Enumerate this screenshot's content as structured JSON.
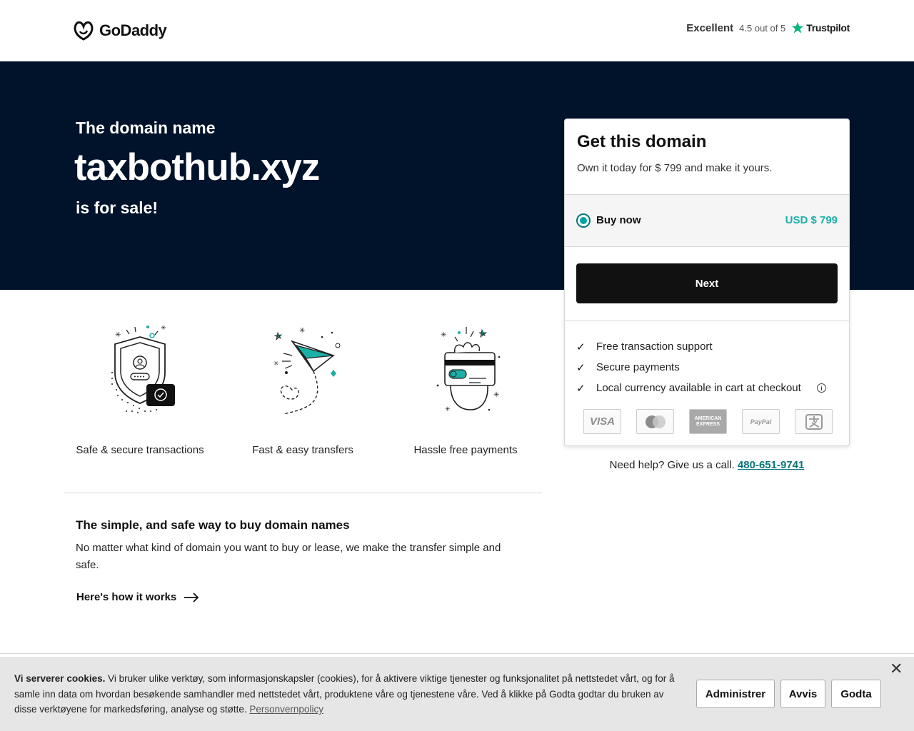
{
  "header": {
    "brand": "GoDaddy",
    "trustpilot": {
      "rating_label": "Excellent",
      "score": "4.5 out of 5",
      "brand": "Trustpilot"
    }
  },
  "hero": {
    "pre_text": "The domain name",
    "domain": "taxbothub.xyz",
    "post_text": "is for sale!"
  },
  "card": {
    "title": "Get this domain",
    "subtitle": "Own it today for $ 799 and make it yours.",
    "option_label": "Buy now",
    "option_price": "USD $ 799",
    "next_label": "Next",
    "features": [
      "Free transaction support",
      "Secure payments",
      "Local currency available in cart at checkout"
    ],
    "payment_methods": [
      "VISA",
      "Mastercard",
      "AMERICAN EXPRESS",
      "PayPal",
      "Alipay"
    ]
  },
  "help": {
    "text": "Need help? Give us a call.",
    "phone": "480-651-9741"
  },
  "benefits": [
    {
      "label": "Safe & secure transactions",
      "icon": "shield-icon"
    },
    {
      "label": "Fast & easy transfers",
      "icon": "paper-plane-icon"
    },
    {
      "label": "Hassle free payments",
      "icon": "card-hand-icon"
    }
  ],
  "info": {
    "title": "The simple, and safe way to buy domain names",
    "body": "No matter what kind of domain you want to buy or lease, we make the transfer simple and safe.",
    "link": "Here's how it works"
  },
  "cookie": {
    "lead": "Vi serverer cookies.",
    "body": " Vi bruker ulike verktøy, som informasjonskapsler (cookies), for å aktivere viktige tjenester og funksjonalitet på nettstedet vårt, og for å samle inn data om hvordan besøkende samhandler med nettstedet vårt, produktene våre og tjenestene våre. Ved å klikke på Godta godtar du bruken av disse verktøyene for markedsføring, analyse og støtte. ",
    "policy_link": "Personvernpolicy",
    "buttons": {
      "manage": "Administrer",
      "reject": "Avvis",
      "accept": "Godta"
    }
  },
  "colors": {
    "hero_bg": "#00132b",
    "accent": "#1bafa7",
    "link": "#09757a",
    "trustpilot_star": "#00b67a"
  }
}
